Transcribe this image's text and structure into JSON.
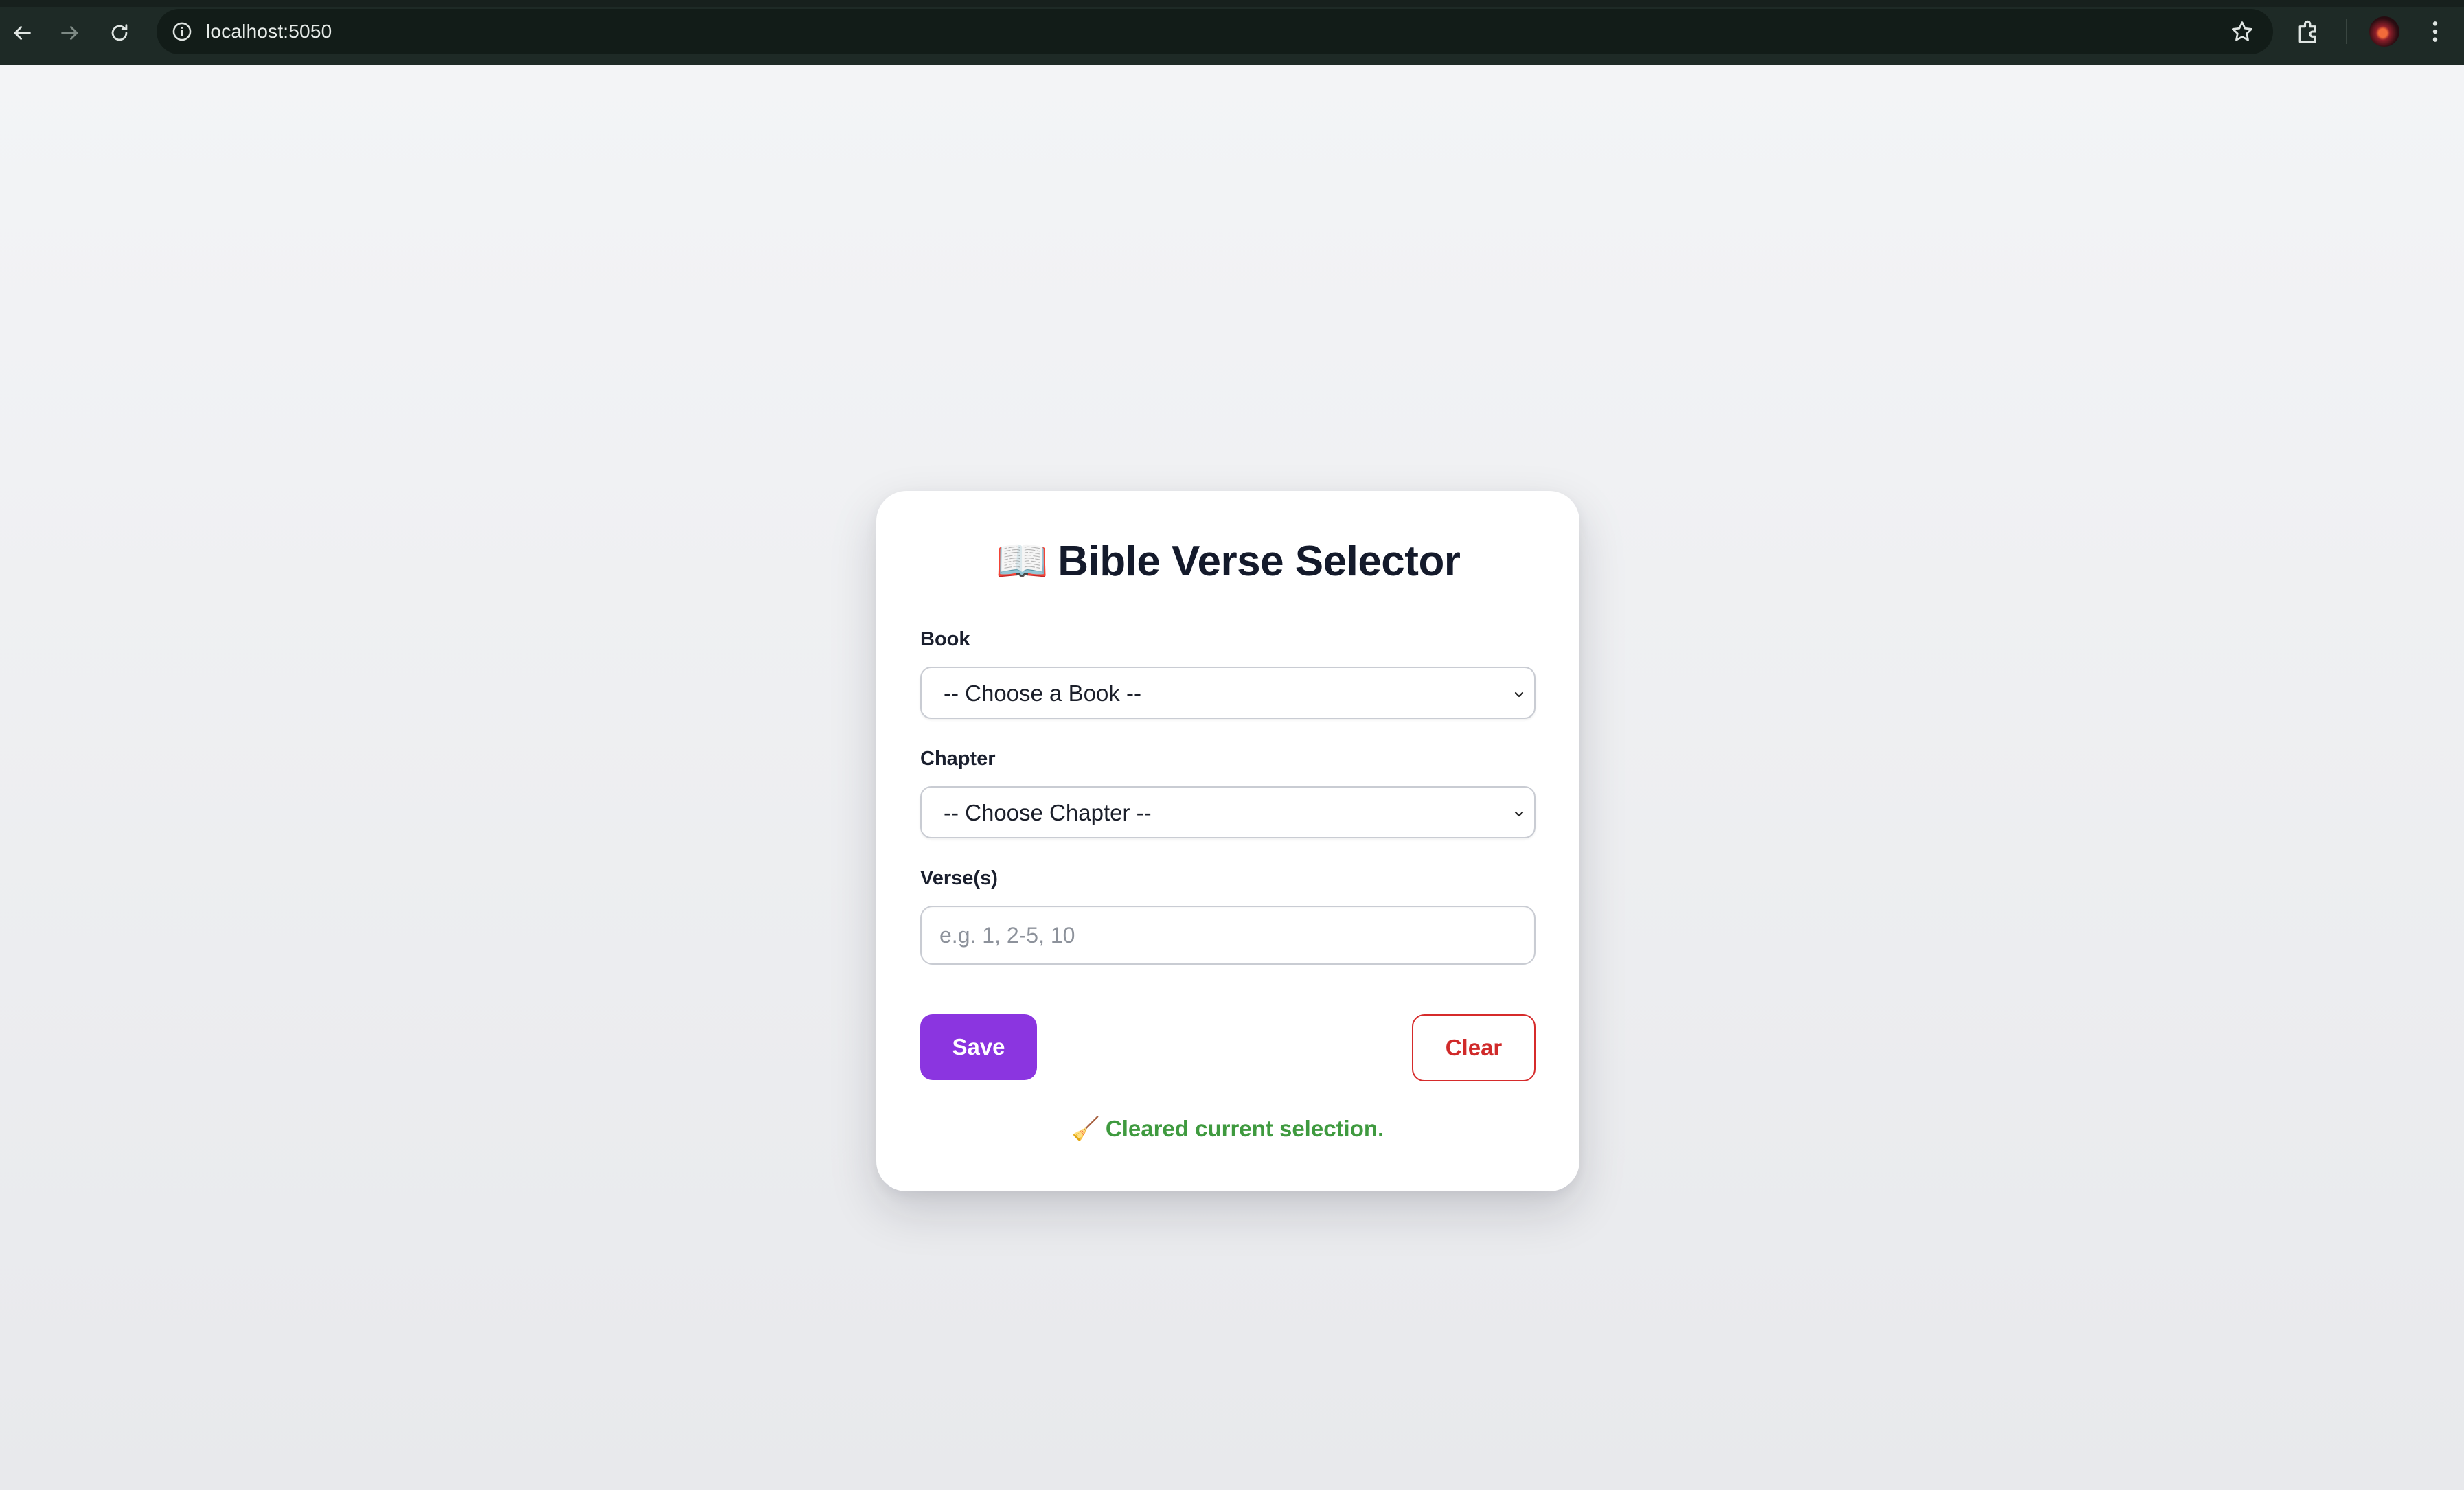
{
  "browser": {
    "url": "localhost:5050",
    "icons": [
      "back-icon",
      "forward-icon",
      "reload-icon",
      "info-icon",
      "star-icon",
      "extensions-icon",
      "profile-avatar",
      "menu-icon"
    ]
  },
  "app": {
    "title_icon": "📖",
    "title": "Bible Verse Selector",
    "book": {
      "label": "Book",
      "selected": "-- Choose a Book --"
    },
    "chapter": {
      "label": "Chapter",
      "selected": "-- Choose Chapter --"
    },
    "verses": {
      "label": "Verse(s)",
      "value": "",
      "placeholder": "e.g. 1, 2-5, 10"
    },
    "save_label": "Save",
    "clear_label": "Clear",
    "status_icon": "🧹",
    "status_text": "Cleared current selection.",
    "colors": {
      "primary": "#8b35e0",
      "danger": "#d02a2a",
      "success": "#3f9a3f"
    }
  }
}
